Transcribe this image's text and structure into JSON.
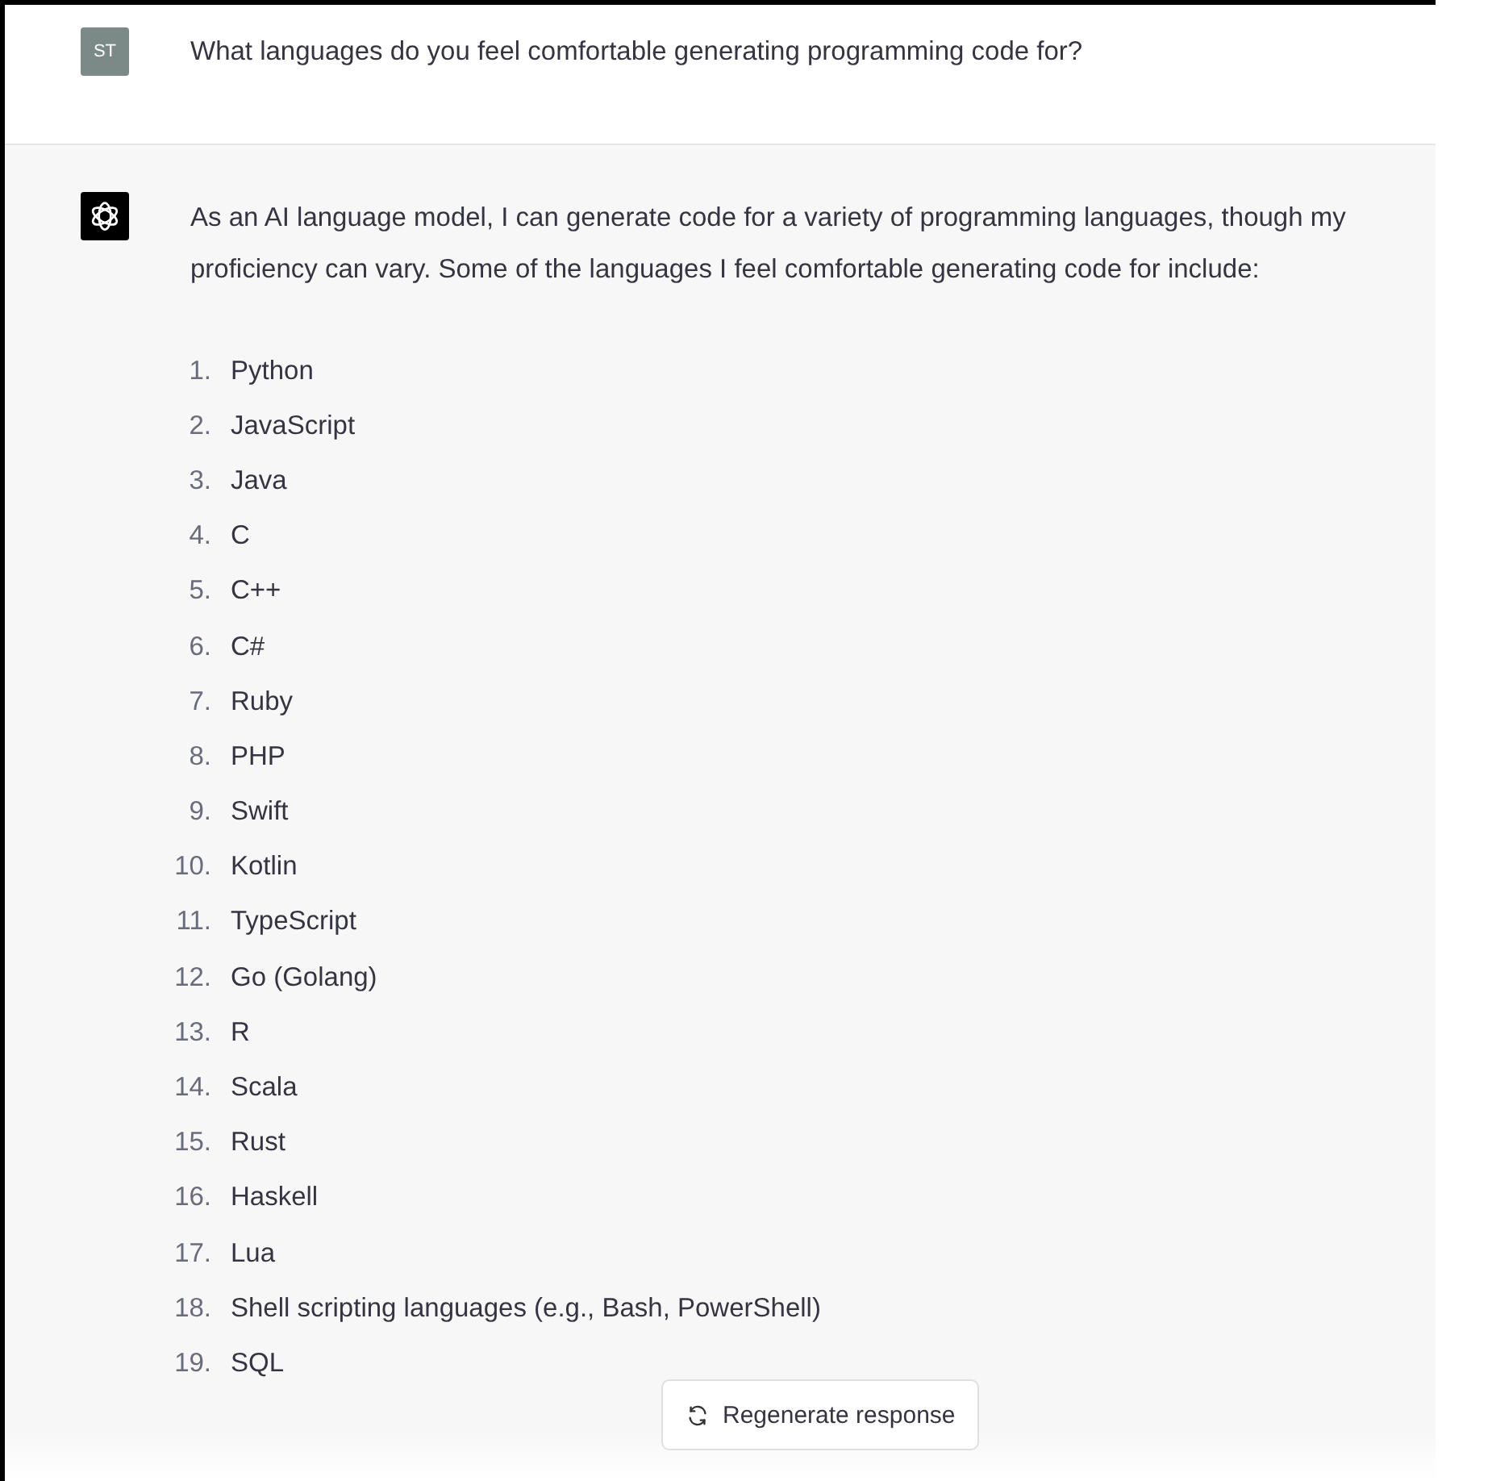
{
  "user_message": {
    "avatar": "ST",
    "text": "What languages do you feel comfortable generating programming code for?"
  },
  "assistant_message": {
    "intro": "As an AI language model, I can generate code for a variety of programming languages, though my proficiency can vary. Some of the languages I feel comfortable generating code for include:",
    "list": [
      {
        "number": "1.",
        "text": "Python"
      },
      {
        "number": "2.",
        "text": "JavaScript"
      },
      {
        "number": "3.",
        "text": "Java"
      },
      {
        "number": "4.",
        "text": "C"
      },
      {
        "number": "5.",
        "text": "C++"
      },
      {
        "number": "6.",
        "text": "C#"
      },
      {
        "number": "7.",
        "text": "Ruby"
      },
      {
        "number": "8.",
        "text": "PHP"
      },
      {
        "number": "9.",
        "text": "Swift"
      },
      {
        "number": "10.",
        "text": "Kotlin"
      },
      {
        "number": "11.",
        "text": "TypeScript"
      },
      {
        "number": "12.",
        "text": "Go (Golang)"
      },
      {
        "number": "13.",
        "text": "R"
      },
      {
        "number": "14.",
        "text": "Scala"
      },
      {
        "number": "15.",
        "text": "Rust"
      },
      {
        "number": "16.",
        "text": "Haskell"
      },
      {
        "number": "17.",
        "text": "Lua"
      },
      {
        "number": "18.",
        "text": "Shell scripting languages (e.g., Bash, PowerShell)"
      },
      {
        "number": "19.",
        "text": "SQL"
      }
    ]
  },
  "regenerate_button": {
    "label": "Regenerate response"
  }
}
